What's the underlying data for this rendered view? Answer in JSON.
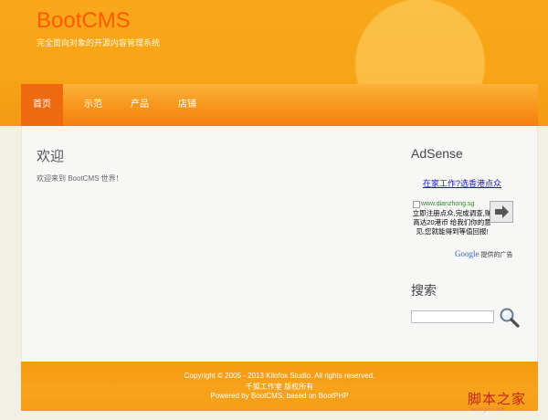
{
  "site": {
    "title": "BootCMS",
    "slogan": "完全面向对象的开源内容管理系统"
  },
  "nav": {
    "items": [
      {
        "label": "首页",
        "active": true
      },
      {
        "label": "示范",
        "active": false
      },
      {
        "label": "产品",
        "active": false
      },
      {
        "label": "店铺",
        "active": false
      }
    ]
  },
  "main": {
    "heading": "欢迎",
    "text": "欢迎来到 BootCMS 世界！"
  },
  "sidebar": {
    "adsense_title": "AdSense",
    "ad": {
      "link_text": "在家工作?选香港点众",
      "url": "www.dianzhong.sg",
      "description": "立即注册点众,完成调查,赚高达20港币 给我们你的意见,您就能得到等值回报!",
      "provider_google": "Google",
      "provider_text": "提供的广告"
    },
    "search_title": "搜索",
    "search_value": ""
  },
  "footer": {
    "line1": "Copyright © 2005 - 2013 Kilofox Studio. All rights reserved.",
    "line2": "千狐工作室 版权所有",
    "line3": "Powered by BootCMS, based on BootPHP"
  },
  "watermark": {
    "text": "脚本之家",
    "sub": "www.jb51.net"
  },
  "colors": {
    "brand_title": "#ff5a00",
    "header": "#f7a416",
    "nav_active": "#ef6a0f",
    "footer": "#f79a10"
  }
}
